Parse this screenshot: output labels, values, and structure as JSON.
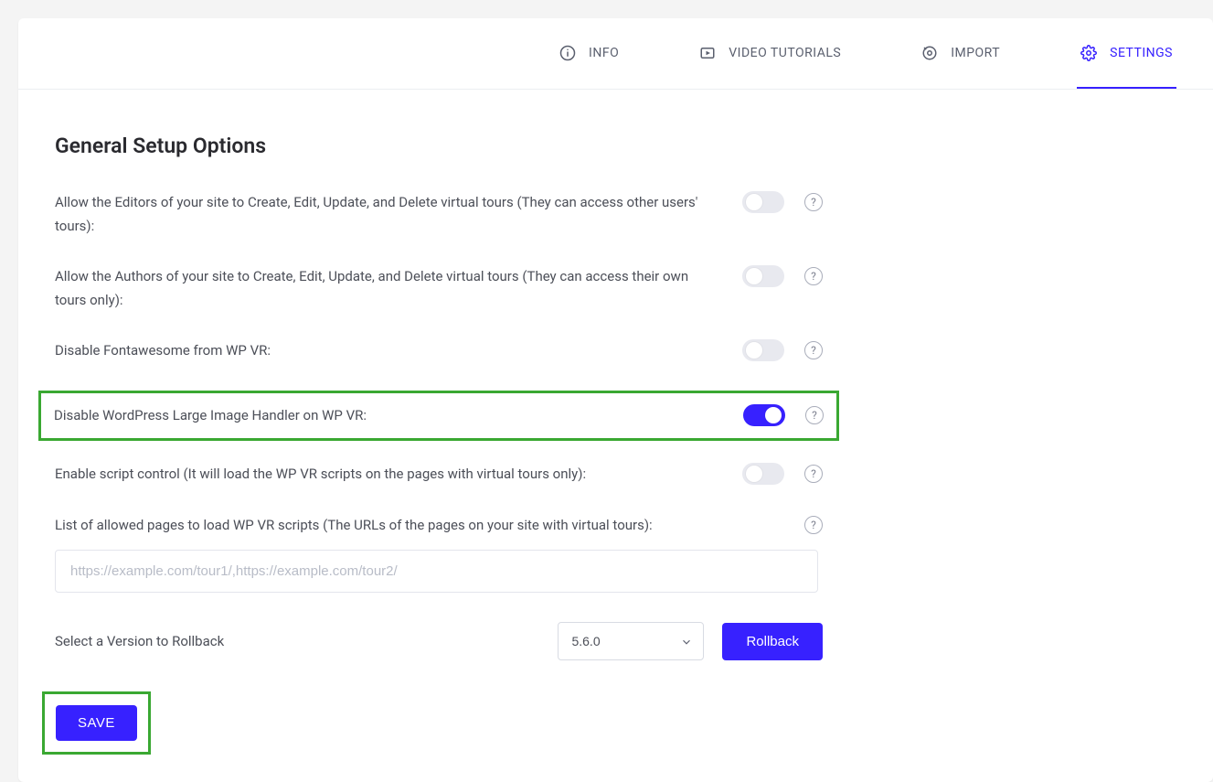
{
  "tabs": {
    "info": {
      "label": "INFO"
    },
    "video": {
      "label": "VIDEO TUTORIALS"
    },
    "import": {
      "label": "IMPORT"
    },
    "settings": {
      "label": "SETTINGS"
    }
  },
  "heading": "General Setup Options",
  "options": {
    "editors": {
      "label": "Allow the Editors of your site to Create, Edit, Update, and Delete virtual tours (They can access other users' tours):"
    },
    "authors": {
      "label": "Allow the Authors of your site to Create, Edit, Update, and Delete virtual tours (They can access their own tours only):"
    },
    "fontawesome": {
      "label": "Disable Fontawesome from WP VR:"
    },
    "largeimg": {
      "label": "Disable WordPress Large Image Handler on WP VR:"
    },
    "scriptctrl": {
      "label": "Enable script control (It will load the WP VR scripts on the pages with virtual tours only):"
    }
  },
  "urllist": {
    "label": "List of allowed pages to load WP VR scripts (The URLs of the pages on your site with virtual tours):",
    "placeholder": "https://example.com/tour1/,https://example.com/tour2/"
  },
  "rollback": {
    "label": "Select a Version to Rollback",
    "selected": "5.6.0",
    "button": "Rollback"
  },
  "save_label": "SAVE",
  "help_glyph": "?"
}
